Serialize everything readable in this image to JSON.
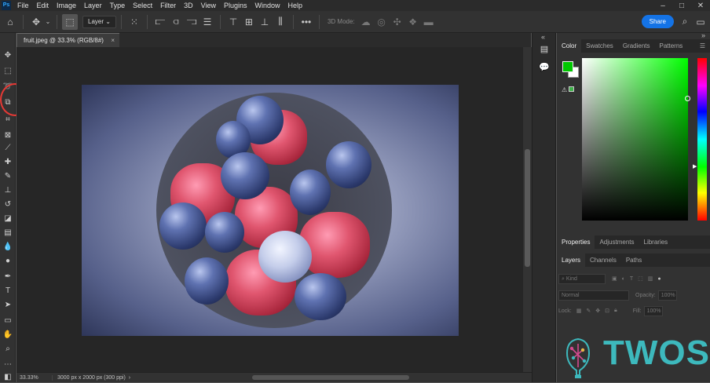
{
  "menubar": {
    "logo": "Ps",
    "items": [
      "File",
      "Edit",
      "Image",
      "Layer",
      "Type",
      "Select",
      "Filter",
      "3D",
      "View",
      "Plugins",
      "Window",
      "Help"
    ],
    "window_controls": [
      "–",
      "□",
      "✕"
    ]
  },
  "options_bar": {
    "layer_select": "Layer",
    "mode_label": "3D Mode:",
    "share_label": "Share"
  },
  "document": {
    "tab_title": "fruit.jpeg @ 33.3% (RGB/8#)",
    "close_glyph": "×"
  },
  "status_bar": {
    "zoom": "33.33%",
    "doc_info": "3000 px x 2000 px (300 ppi)"
  },
  "color_panel": {
    "tabs": [
      "Color",
      "Swatches",
      "Gradients",
      "Patterns"
    ],
    "active_tab": "Color",
    "foreground": "#00c800",
    "background": "#ffffff",
    "hue": "#00ff00"
  },
  "properties_panel": {
    "tabs": [
      "Properties",
      "Adjustments",
      "Libraries"
    ]
  },
  "layers_panel": {
    "tabs": [
      "Layers",
      "Channels",
      "Paths"
    ],
    "filter_label": "Kind",
    "blend_mode": "Normal",
    "opacity_label": "Opacity:",
    "opacity_value": "100%",
    "lock_label": "Lock:",
    "fill_label": "Fill:",
    "fill_value": "100%"
  },
  "watermark": {
    "text": "TWOS",
    "color": "#3db9bd"
  },
  "icons": {
    "dock_expand": "«",
    "panel_collapse": "»"
  }
}
